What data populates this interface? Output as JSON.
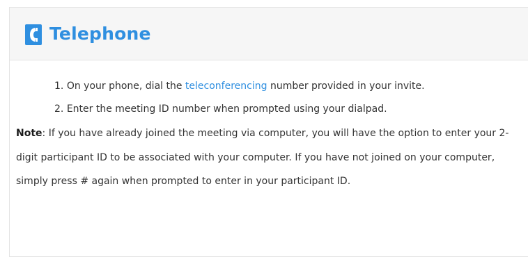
{
  "panel": {
    "icon": "phone-icon",
    "title": "Telephone",
    "accent_color": "#2f8fe0"
  },
  "steps": [
    {
      "number": "1.",
      "before": "On your phone, dial the",
      "link": "teleconferencing",
      "after": "number provided in your invite."
    },
    {
      "number": "2.",
      "text": "Enter the meeting ID number when prompted using your dialpad."
    }
  ],
  "note": {
    "label": "Note",
    "text": ": If you have already joined the meeting via computer, you will have the option to enter your 2-digit participant ID to be associated with your computer. If you have not joined on your computer, simply press # again when prompted to enter in your participant ID."
  }
}
